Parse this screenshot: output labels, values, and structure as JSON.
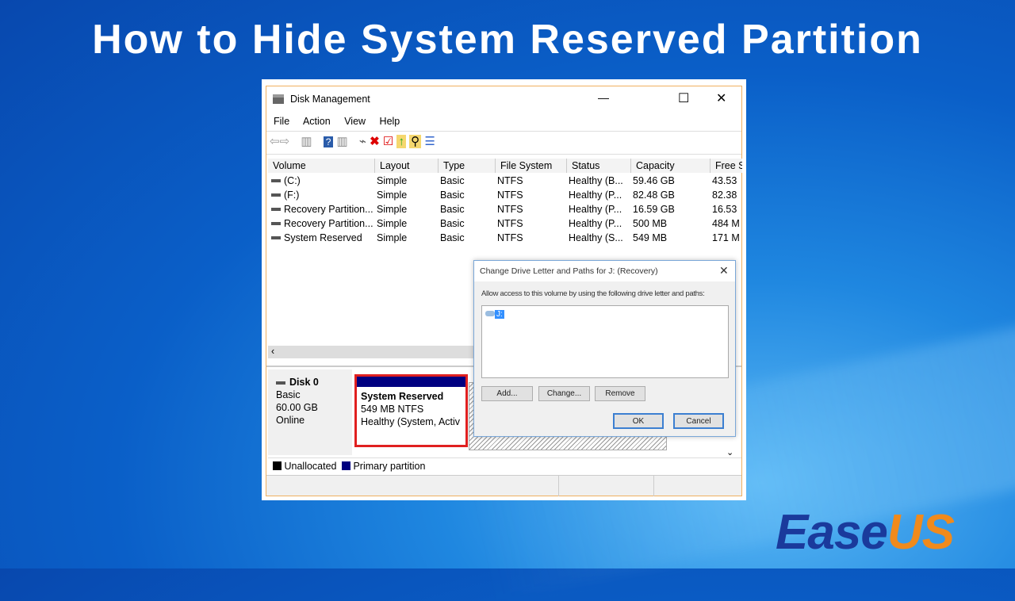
{
  "page_title": "How to Hide System Reserved Partition",
  "window": {
    "title": "Disk Management",
    "minimize": "—",
    "maximize": "☐",
    "close": "✕",
    "menu": [
      "File",
      "Action",
      "View",
      "Help"
    ]
  },
  "columns": [
    "Volume",
    "Layout",
    "Type",
    "File System",
    "Status",
    "Capacity",
    "Free S"
  ],
  "volumes": [
    [
      "(C:)",
      "Simple",
      "Basic",
      "NTFS",
      "Healthy (B...",
      "59.46 GB",
      "43.53"
    ],
    [
      "(F:)",
      "Simple",
      "Basic",
      "NTFS",
      "Healthy (P...",
      "82.48 GB",
      "82.38"
    ],
    [
      "Recovery Partition...",
      "Simple",
      "Basic",
      "NTFS",
      "Healthy (P...",
      "16.59 GB",
      "16.53"
    ],
    [
      "Recovery Partition...",
      "Simple",
      "Basic",
      "NTFS",
      "Healthy (P...",
      "500 MB",
      "484 M"
    ],
    [
      "System Reserved",
      "Simple",
      "Basic",
      "NTFS",
      "Healthy (S...",
      "549 MB",
      "171 M"
    ]
  ],
  "disk": {
    "name": "Disk 0",
    "type": "Basic",
    "size": "60.00 GB",
    "state": "Online"
  },
  "partition": {
    "name": "System Reserved",
    "size": "549 MB NTFS",
    "status": "Healthy (System, Activ"
  },
  "legend": [
    "Unallocated",
    "Primary partition"
  ],
  "dialog": {
    "title": "Change Drive Letter and Paths for J: (Recovery)",
    "close": "✕",
    "prompt": "Allow access to this volume by using the following drive letter and paths:",
    "entry": "J:",
    "add": "Add...",
    "change": "Change...",
    "remove": "Remove",
    "ok": "OK",
    "cancel": "Cancel"
  },
  "brand": {
    "part1": "Ease",
    "part2": "US",
    "color1": "#1a3a9c",
    "color2": "#f08a1c"
  }
}
